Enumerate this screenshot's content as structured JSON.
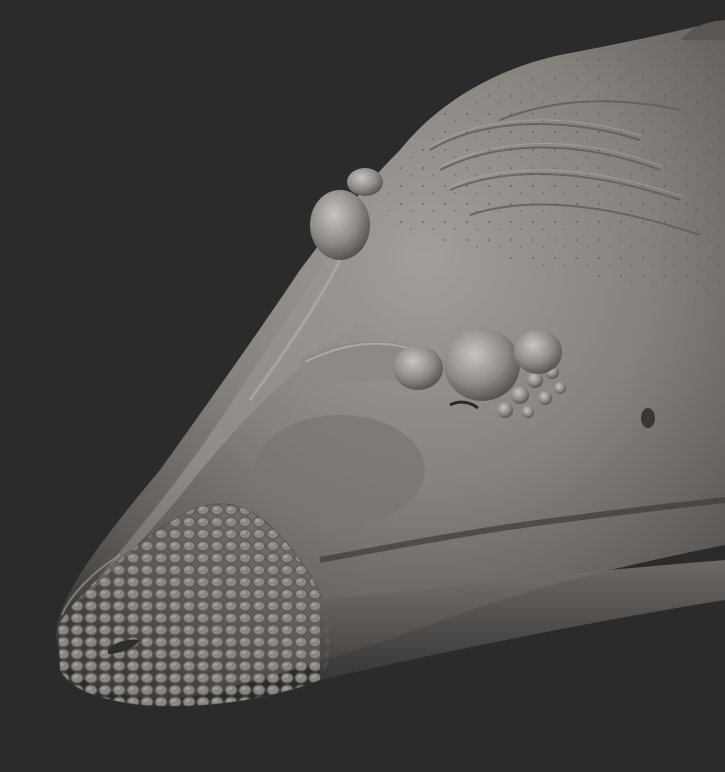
{
  "scene": {
    "background_color": "#2b2b2b",
    "model_base_color": "#8f8b88",
    "model_shadow_color": "#4a4846",
    "model_highlight_color": "#cfcbc7"
  }
}
